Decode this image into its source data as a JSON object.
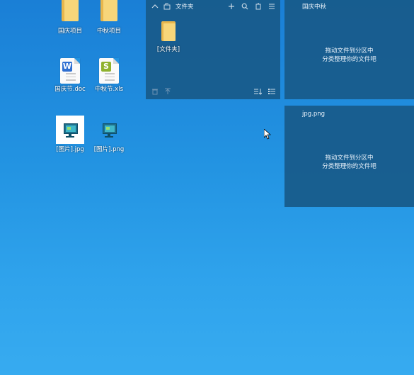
{
  "desktop": {
    "icons": [
      {
        "label": "国庆项目",
        "type": "folder"
      },
      {
        "label": "中秋项目",
        "type": "folder"
      },
      {
        "label": "国庆节.doc",
        "type": "word",
        "letter": "W"
      },
      {
        "label": "中秋节.xls",
        "type": "excel",
        "letter": "S"
      },
      {
        "label": "[图片].jpg",
        "type": "image",
        "selected": true
      },
      {
        "label": "[图片].png",
        "type": "image",
        "selected": false
      }
    ]
  },
  "fences": [
    {
      "title": "文件夹",
      "items": [
        {
          "label": "[文件夹]",
          "type": "folder"
        }
      ],
      "toolbar_icons": [
        "collapse-icon",
        "open-folder-icon",
        "add-icon",
        "search-icon",
        "copy-icon",
        "menu-icon"
      ],
      "footer_icons": [
        "trash-icon",
        "up-arrow-icon",
        "sort-icon",
        "list-view-icon"
      ]
    },
    {
      "title": "国庆中秋",
      "hint_line1": "拖动文件到分区中",
      "hint_line2": "分类整理你的文件吧"
    },
    {
      "title": "jpg.png",
      "hint_line1": "拖动文件到分区中",
      "hint_line2": "分类整理你的文件吧"
    }
  ],
  "colors": {
    "desktop_top": "#1a7fd6",
    "desktop_bottom": "#37abf0",
    "fence_bg": "#185a8a",
    "folder": "#f7d67a",
    "word": "#2f6fd1",
    "excel": "#8fb22e"
  }
}
